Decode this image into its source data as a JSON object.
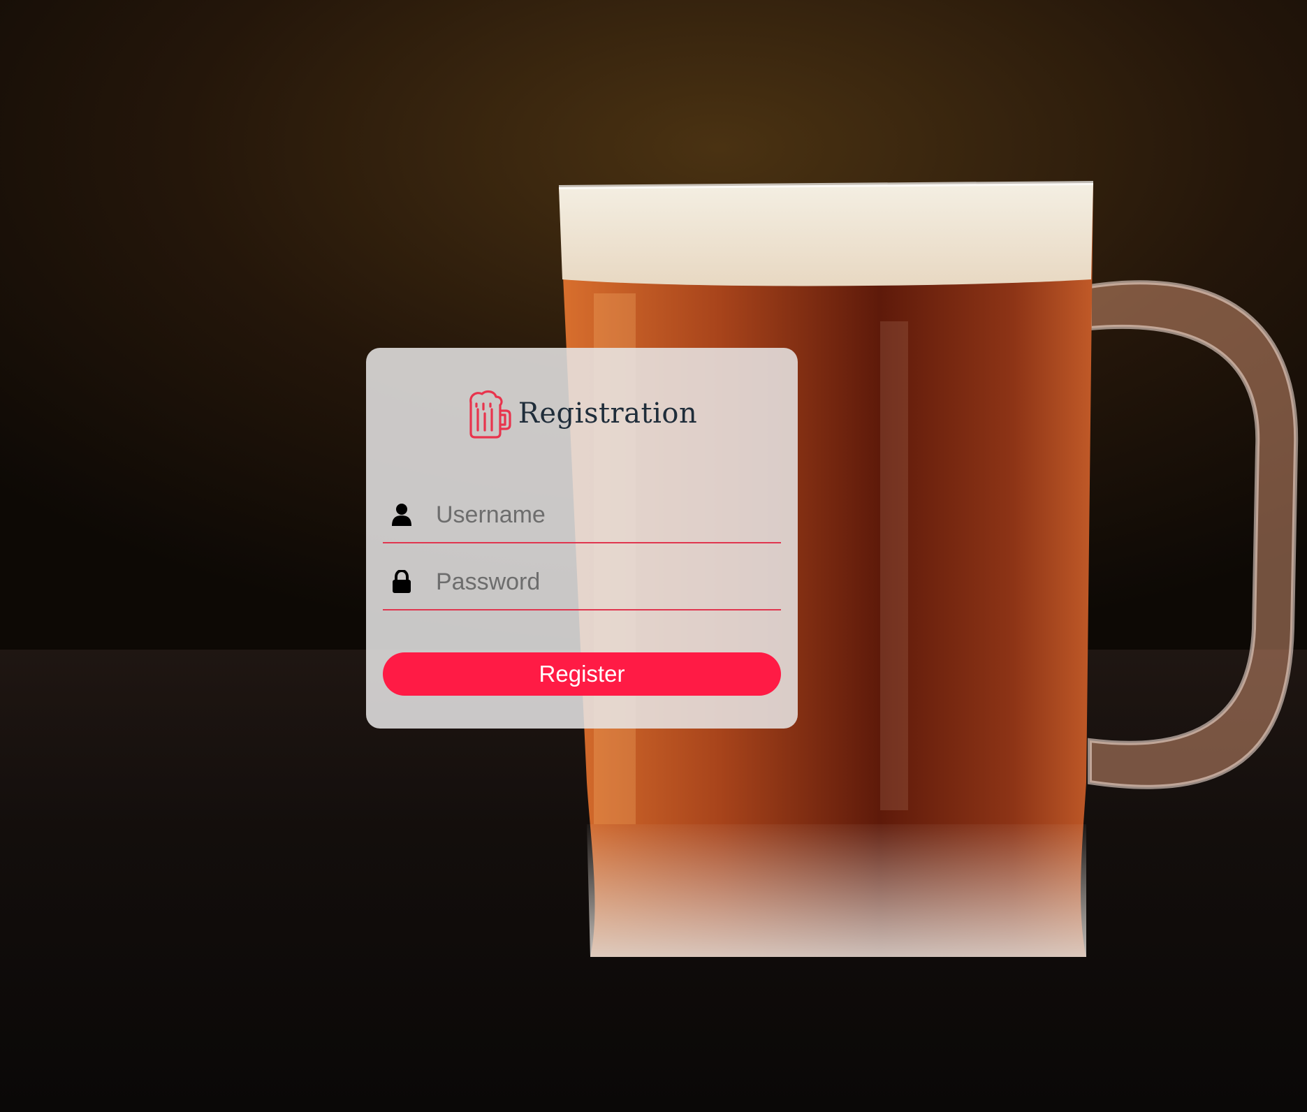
{
  "page": {
    "background": "beer-mug-photo",
    "accent_color": "#ff1b45",
    "card_color": "#e8e6e6"
  },
  "card": {
    "logo_icon": "beer-mug-icon",
    "title": "Registration",
    "fields": {
      "username": {
        "icon": "user-icon",
        "placeholder": "Username",
        "value": ""
      },
      "password": {
        "icon": "lock-icon",
        "placeholder": "Password",
        "value": ""
      }
    },
    "submit_label": "Register"
  }
}
